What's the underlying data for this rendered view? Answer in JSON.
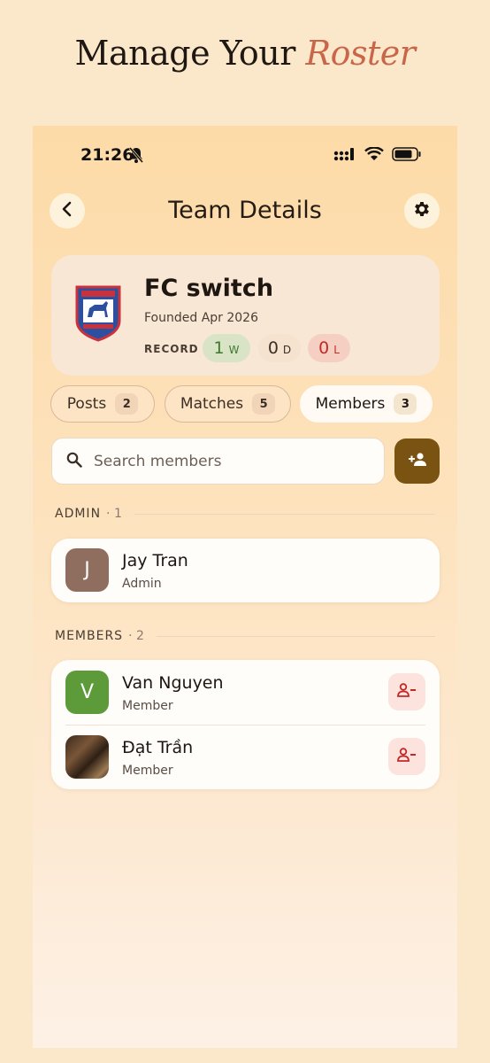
{
  "headline": {
    "prefix": "Manage Your",
    "accent": "Roster"
  },
  "status_bar": {
    "time": "21:26"
  },
  "header": {
    "title": "Team Details"
  },
  "team": {
    "name": "FC switch",
    "founded": "Founded Apr 2026",
    "record_label": "RECORD",
    "record": {
      "wins": "1",
      "wins_unit": "W",
      "draws": "0",
      "draws_unit": "D",
      "losses": "0",
      "losses_unit": "L"
    }
  },
  "tabs": [
    {
      "label": "Posts",
      "count": "2"
    },
    {
      "label": "Matches",
      "count": "5"
    },
    {
      "label": "Members",
      "count": "3"
    }
  ],
  "search": {
    "placeholder": "Search members"
  },
  "sections": {
    "admin": {
      "label": "ADMIN",
      "count": "· 1"
    },
    "members": {
      "label": "MEMBERS",
      "count": "· 2"
    }
  },
  "admins": [
    {
      "initial": "J",
      "name": "Jay Tran",
      "role": "Admin"
    }
  ],
  "members": [
    {
      "initial": "V",
      "name": "Van Nguyen",
      "role": "Member"
    },
    {
      "initial": "",
      "name": "Đạt Trần",
      "role": "Member"
    }
  ],
  "colors": {
    "accent": "#c9664a",
    "add_button": "#7a5212",
    "win": "#3e7a2e",
    "loss": "#c22a2a",
    "avatar_admin": "#8f6e60",
    "avatar_member": "#5c9a3a"
  },
  "icons": [
    "bell-off-icon",
    "signal-icon",
    "wifi-icon",
    "battery-icon",
    "back-arrow-icon",
    "gear-icon",
    "search-icon",
    "add-person-icon",
    "remove-person-icon"
  ]
}
